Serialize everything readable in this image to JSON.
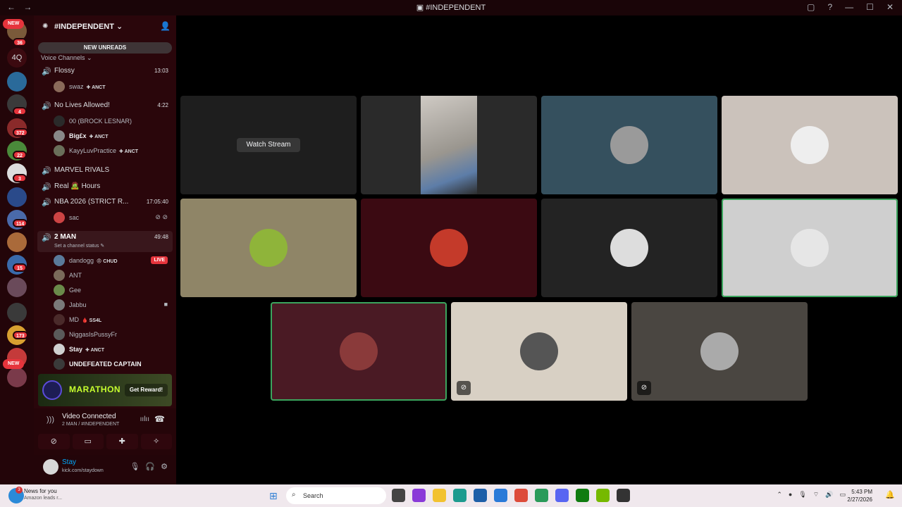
{
  "window": {
    "title": "#INDEPENDENT",
    "back": "←",
    "forward": "→"
  },
  "servers": {
    "pills": [
      {
        "label": "NEW",
        "pos": "top"
      },
      {
        "label": "NEW",
        "pos": "bottom"
      }
    ],
    "badges": [
      "36",
      "4",
      "372",
      "22",
      "3",
      "114",
      "15",
      "173"
    ],
    "text_server": "4Q"
  },
  "guild": {
    "name": "#INDEPENDENT",
    "new_unreads": "NEW UNREADS",
    "category": "Voice Channels"
  },
  "voice_channels": [
    {
      "name": "Flossy",
      "time": "13:03",
      "users": [
        {
          "name": "swaz",
          "tag": "ANCT",
          "avatar": "#8a6a5a"
        }
      ]
    },
    {
      "name": "No Lives Allowed!",
      "time": "4:22",
      "users": [
        {
          "name": "00 (BROCK LESNAR)",
          "tag": "",
          "avatar": "#2a2a2a"
        },
        {
          "name": "Big£x",
          "tag": "ANCT",
          "avatar": "#888888"
        },
        {
          "name": "KayyLuvPractice",
          "tag": "ANCT",
          "avatar": "#6a6f5a"
        }
      ]
    },
    {
      "name": "MARVEL RIVALS",
      "time": "",
      "users": []
    },
    {
      "name": "Real 🧟 Hours",
      "time": "",
      "users": []
    },
    {
      "name": "NBA 2026 (STRICT R...",
      "time": "17:05:40",
      "users": [
        {
          "name": "sac",
          "tag": "",
          "avatar": "#c44"
        }
      ]
    },
    {
      "name": "2 MAN",
      "time": "49:48",
      "status": "Set a channel status",
      "users": [
        {
          "name": "dandogg",
          "tag": "😠 CHUD",
          "avatar": "#5a7a9a",
          "live": "LIVE"
        },
        {
          "name": "ANT",
          "tag": "",
          "avatar": "#7a6a5a"
        },
        {
          "name": "Gee",
          "tag": "",
          "avatar": "#6a8a4a"
        },
        {
          "name": "Jabbu",
          "tag": "",
          "avatar": "#7a7a7a",
          "cam": true
        },
        {
          "name": "MD",
          "tag": "🩸 SS4L",
          "avatar": "#4a2a2a"
        },
        {
          "name": "NiggasIsPussyFr",
          "tag": "",
          "avatar": "#5a5a5a"
        },
        {
          "name": "Stay",
          "tag": "ANCT",
          "avatar": "#d0d0d0"
        },
        {
          "name": "UNDEFEATED CAPTAIN",
          "tag": "",
          "avatar": "#3a3a3a"
        }
      ]
    }
  ],
  "promo": {
    "title": "MARATHON",
    "button": "Get Reward!"
  },
  "rtc": {
    "title": "Video Connected",
    "subtitle": "2 MAN / #INDEPENDENT"
  },
  "user_panel": {
    "name": "Stay",
    "status": "kick.com/staydown"
  },
  "tiles": [
    {
      "kind": "stream",
      "bg": "#1e1e1e",
      "label": "Watch Stream"
    },
    {
      "kind": "video",
      "bg": "#2a2a2a"
    },
    {
      "kind": "avatar",
      "bg": "#35505e",
      "face": "#9a9a9a"
    },
    {
      "kind": "avatar",
      "bg": "#cbc2bb",
      "face": "#eeeeee"
    },
    {
      "kind": "avatar",
      "bg": "#8f8567",
      "face": "#8fb43a"
    },
    {
      "kind": "avatar",
      "bg": "#3b0a12",
      "face": "#c43a2a"
    },
    {
      "kind": "avatar",
      "bg": "#232323",
      "face": "#dddddd"
    },
    {
      "kind": "avatar",
      "bg": "#cfcfcf",
      "face": "#e6e6e6",
      "speaking": true
    },
    {
      "kind": "avatar",
      "bg": "#4a1a24",
      "face": "#8a3a3a",
      "speaking": true
    },
    {
      "kind": "avatar",
      "bg": "#d8d0c4",
      "face": "#555555",
      "icon": "muted"
    },
    {
      "kind": "avatar",
      "bg": "#4a4641",
      "face": "#aaaaaa",
      "icon": "deafened"
    }
  ],
  "taskbar": {
    "news_title": "News for you",
    "news_sub": "Amazon leads r...",
    "news_badge": "3",
    "search": "Search",
    "time": "5:43 PM",
    "date": "2/27/2026"
  },
  "colors": {
    "accent": "#3ba55d",
    "live": "#e6343c",
    "background": "#2a060b"
  }
}
